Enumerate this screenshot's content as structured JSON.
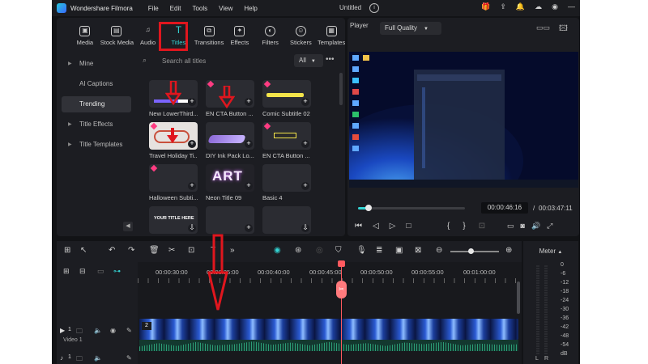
{
  "app": {
    "name": "Wondershare Filmora",
    "menu": [
      "File",
      "Edit",
      "Tools",
      "View",
      "Help"
    ],
    "doc_title": "Untitled"
  },
  "media_tabs": [
    {
      "label": "Media",
      "icon": "media-icon"
    },
    {
      "label": "Stock Media",
      "icon": "stock-media-icon"
    },
    {
      "label": "Audio",
      "icon": "audio-icon"
    },
    {
      "label": "Titles",
      "icon": "titles-icon",
      "active": true
    },
    {
      "label": "Transitions",
      "icon": "transitions-icon"
    },
    {
      "label": "Effects",
      "icon": "effects-icon"
    },
    {
      "label": "Filters",
      "icon": "filters-icon"
    },
    {
      "label": "Stickers",
      "icon": "stickers-icon"
    },
    {
      "label": "Templates",
      "icon": "templates-icon"
    }
  ],
  "sidebar": {
    "items": [
      {
        "label": "Mine",
        "arrow": true
      },
      {
        "label": "AI Captions",
        "arrow": false
      },
      {
        "label": "Trending",
        "arrow": false,
        "active": true
      },
      {
        "label": "Title Effects",
        "arrow": true
      },
      {
        "label": "Title Templates",
        "arrow": true
      }
    ]
  },
  "search": {
    "placeholder": "Search all titles",
    "filter": "All"
  },
  "titles": [
    {
      "caption": "New LowerThird...",
      "style": "lower-third"
    },
    {
      "caption": "EN CTA Button ...",
      "style": "cta"
    },
    {
      "caption": "Comic Subtitle 02",
      "style": "comic"
    },
    {
      "caption": "Travel Holiday Ti...",
      "style": "travel"
    },
    {
      "caption": "DIY Ink Pack Lo...",
      "style": "ink"
    },
    {
      "caption": "EN CTA Button ...",
      "style": "cta2"
    },
    {
      "caption": "Halloween Subti...",
      "style": "halloween"
    },
    {
      "caption": "Neon Title 09",
      "style": "neon",
      "thumb_text": "ART"
    },
    {
      "caption": "Basic 4",
      "style": "basic"
    },
    {
      "caption": "",
      "style": "your-title",
      "thumb_text": "YOUR TITLE HERE"
    },
    {
      "caption": "",
      "style": "blank"
    },
    {
      "caption": "",
      "style": "basic-small"
    }
  ],
  "player": {
    "label": "Player",
    "quality": "Full Quality",
    "current_time": "00:00:46:16",
    "total_time": "00:03:47:11",
    "progress": 0.1
  },
  "timeline": {
    "ruler": [
      "00:00:30:00",
      "00:00:35:00",
      "00:00:40:00",
      "00:00:45:00",
      "00:00:50:00",
      "00:00:55:00",
      "00:01:00:00"
    ],
    "video_track_label": "Video 1",
    "track_numbers": {
      "video": "2",
      "v1": "1",
      "a1": "1"
    }
  },
  "meter": {
    "label": "Meter",
    "scale": [
      "0",
      "-6",
      "-12",
      "-18",
      "-24",
      "-30",
      "-36",
      "-42",
      "-48",
      "-54",
      "dB"
    ],
    "channels": [
      "L",
      "R"
    ]
  },
  "colors": {
    "accent": "#33d3d3",
    "annotation_red": "#e0161e",
    "playhead": "#ff5a5f"
  }
}
